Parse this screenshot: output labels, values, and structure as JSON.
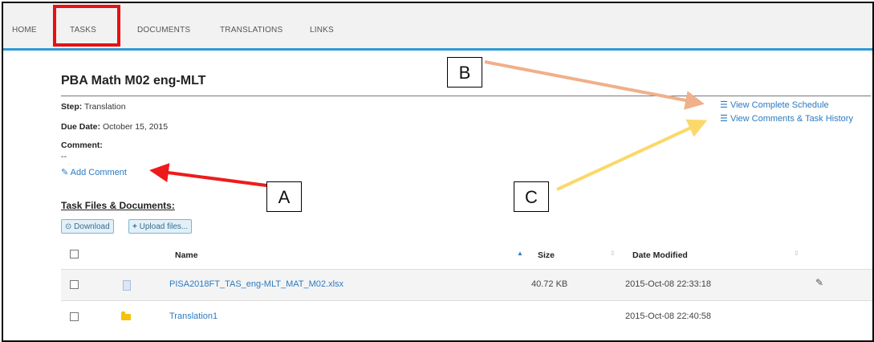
{
  "nav": {
    "items": [
      "HOME",
      "TASKS",
      "DOCUMENTS",
      "TRANSLATIONS",
      "LINKS"
    ],
    "active": "TASKS"
  },
  "task": {
    "title": "PBA Math M02 eng-MLT",
    "step_label": "Step:",
    "step_value": "Translation",
    "due_label": "Due Date:",
    "due_value": "October 15, 2015",
    "comment_label": "Comment:",
    "comment_value": "--",
    "add_comment": "Add Comment"
  },
  "links": {
    "schedule": "View Complete Schedule",
    "history": "View Comments & Task History"
  },
  "files": {
    "header": "Task Files & Documents:",
    "download_button": "Download",
    "upload_button": "Upload files...",
    "columns": {
      "name": "Name",
      "size": "Size",
      "date": "Date Modified"
    },
    "rows": [
      {
        "name": "PISA2018FT_TAS_eng-MLT_MAT_M02.xlsx",
        "size": "40.72 KB",
        "date": "2015-Oct-08 22:33:18",
        "type": "file"
      },
      {
        "name": "Translation1",
        "size": "",
        "date": "2015-Oct-08 22:40:58",
        "type": "folder"
      }
    ]
  },
  "annotations": {
    "a": "A",
    "b": "B",
    "c": "C",
    "colors": {
      "highlight": "#e81010",
      "arrow_a": "#ee1b1b",
      "arrow_b": "#f0b08a",
      "arrow_c": "#fbd869"
    }
  }
}
